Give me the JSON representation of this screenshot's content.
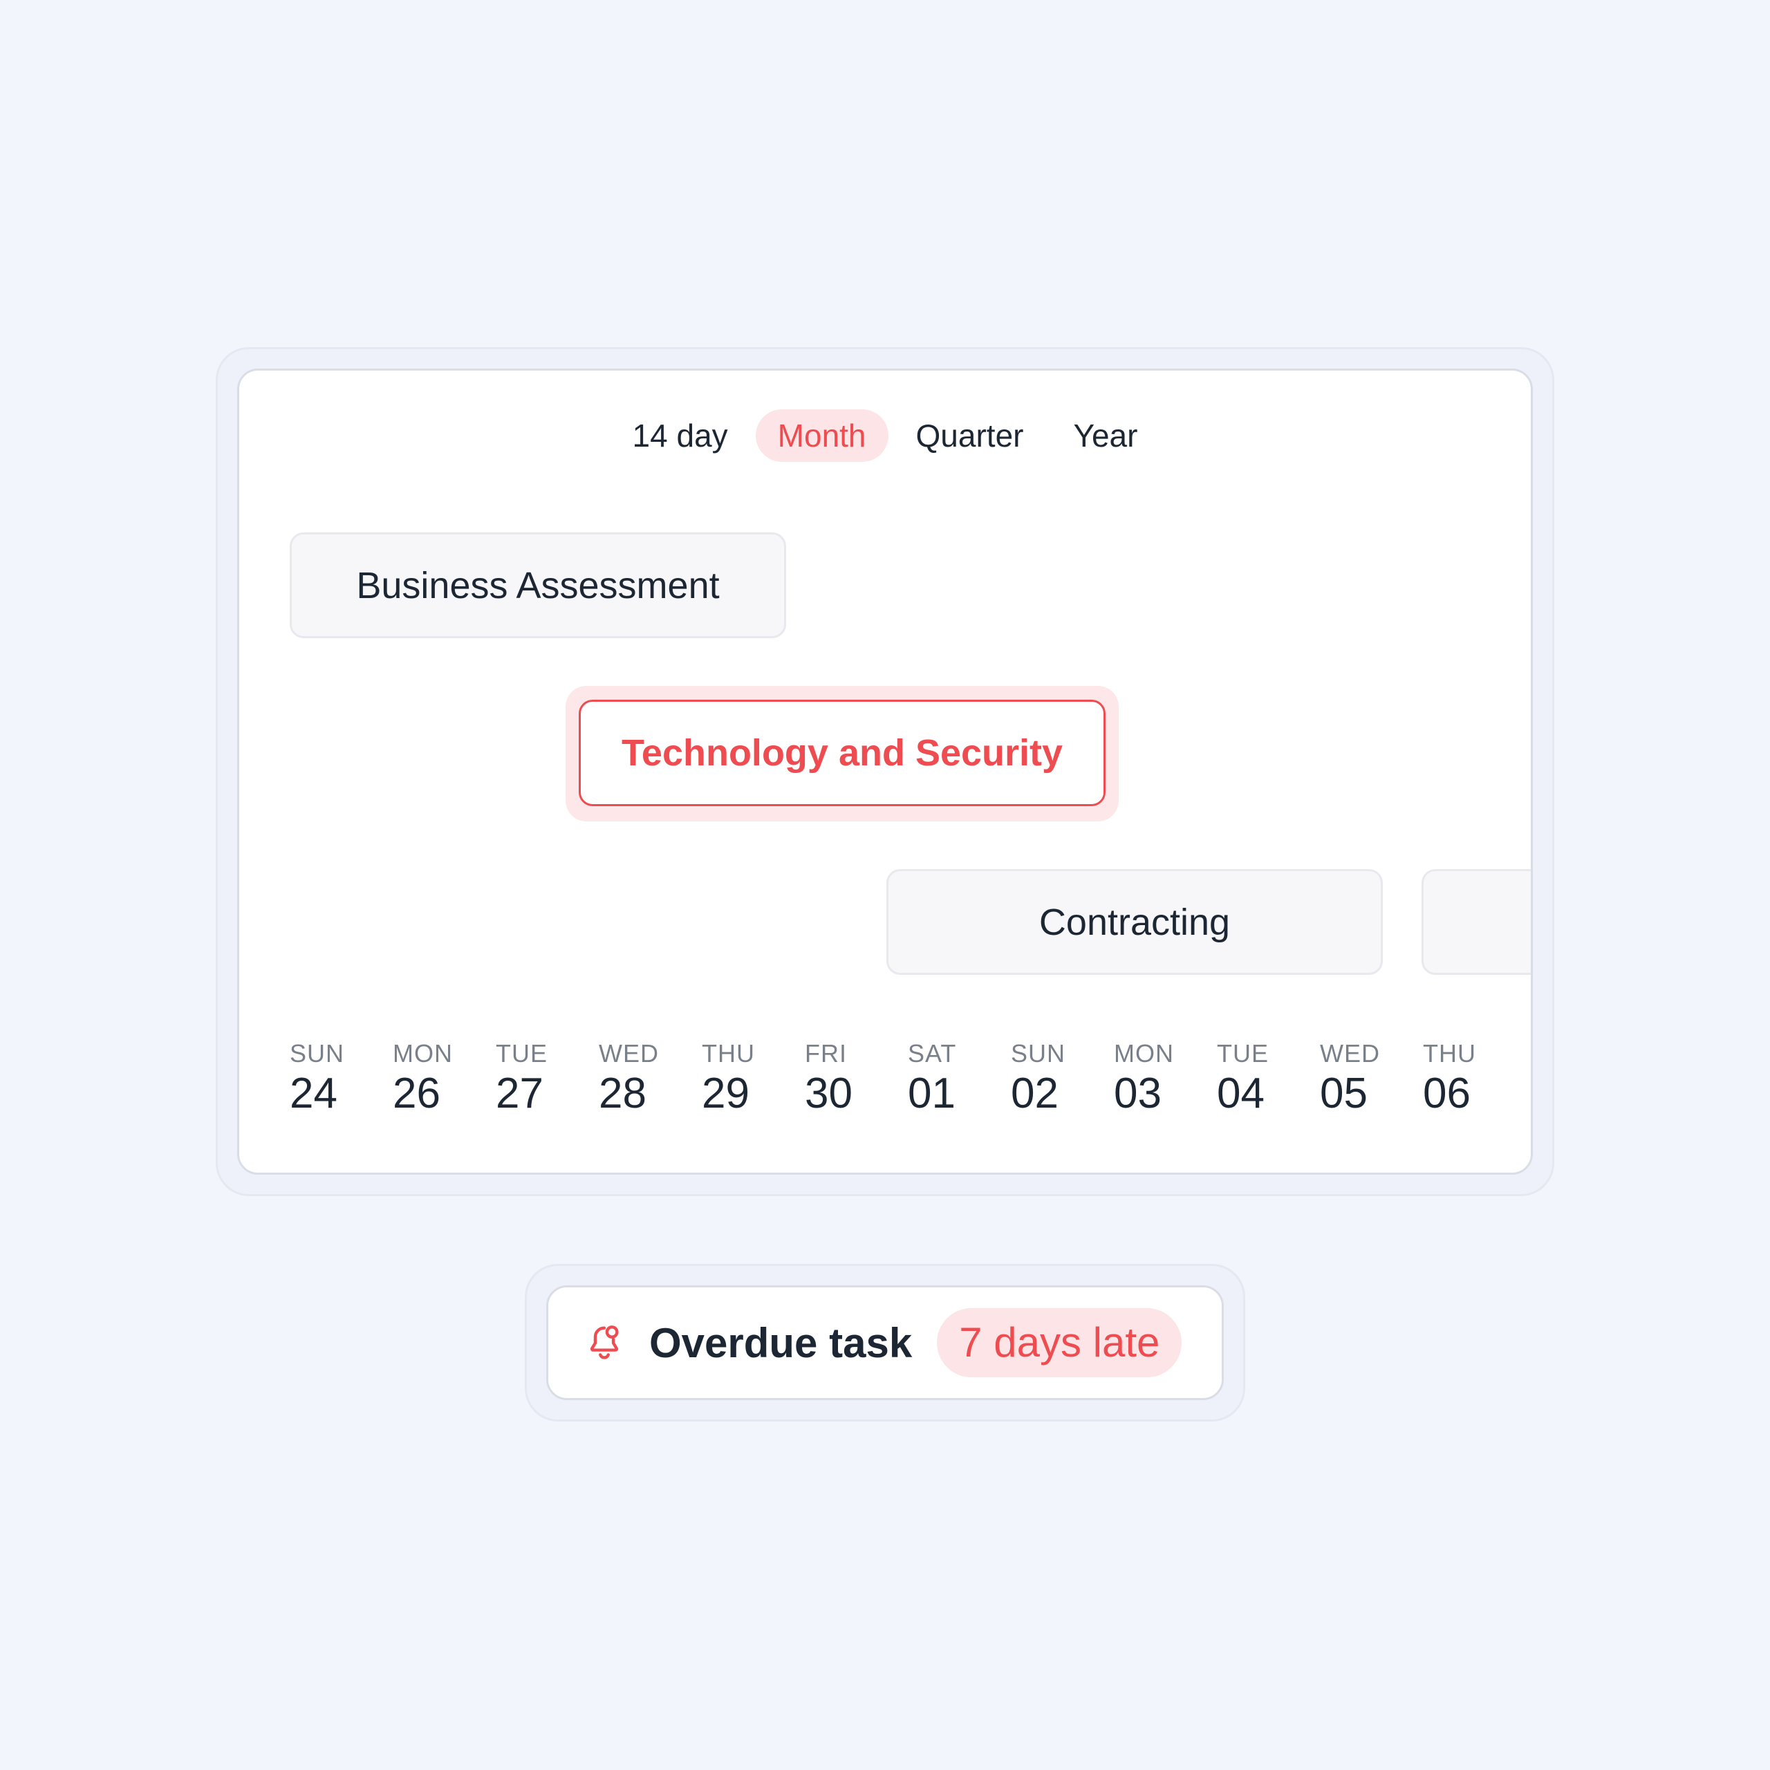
{
  "view_selector": {
    "options": [
      "14 day",
      "Month",
      "Quarter",
      "Year"
    ],
    "selected": "Month"
  },
  "tasks": {
    "business": "Business Assessment",
    "technology": "Technology and Security",
    "contracting": "Contracting"
  },
  "dates": [
    {
      "weekday": "SUN",
      "day": "24"
    },
    {
      "weekday": "MON",
      "day": "26"
    },
    {
      "weekday": "TUE",
      "day": "27"
    },
    {
      "weekday": "WED",
      "day": "28"
    },
    {
      "weekday": "THU",
      "day": "29"
    },
    {
      "weekday": "FRI",
      "day": "30"
    },
    {
      "weekday": "SAT",
      "day": "01"
    },
    {
      "weekday": "SUN",
      "day": "02"
    },
    {
      "weekday": "MON",
      "day": "03"
    },
    {
      "weekday": "TUE",
      "day": "04"
    },
    {
      "weekday": "WED",
      "day": "05"
    },
    {
      "weekday": "THU",
      "day": "06"
    }
  ],
  "notification": {
    "icon": "bell-alert-icon",
    "title": "Overdue task",
    "badge": "7 days late"
  },
  "colors": {
    "accent": "#ee4c50",
    "accent_soft": "#fde4e6",
    "background": "#f3f5fd",
    "text": "#1d2733"
  }
}
